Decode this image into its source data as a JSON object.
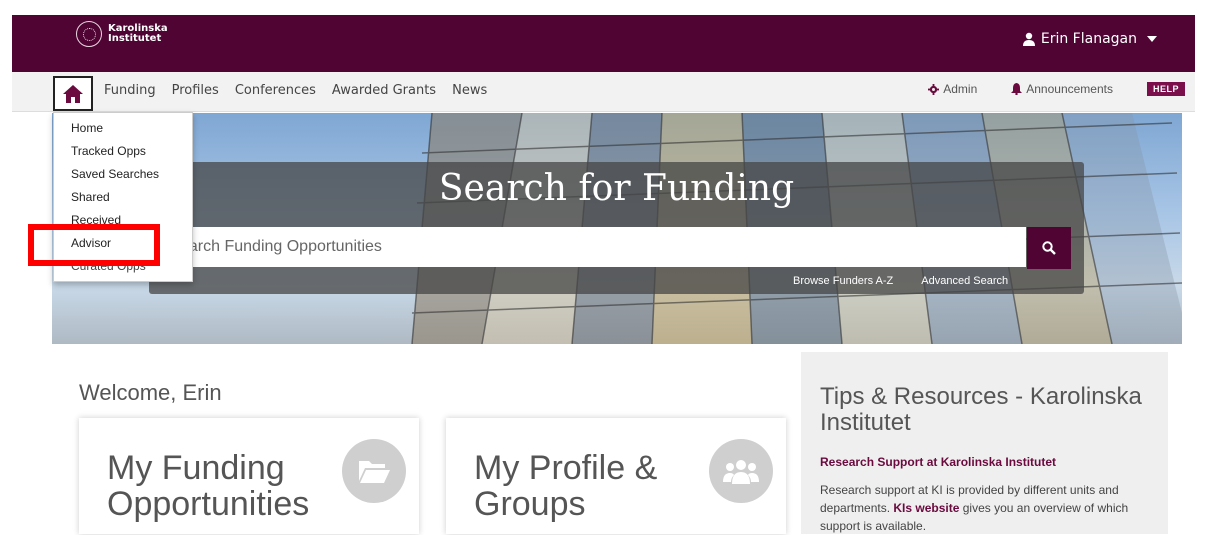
{
  "header": {
    "logo_line1": "Karolinska",
    "logo_line2": "Institutet",
    "user_name": "Erin Flanagan"
  },
  "nav": {
    "links": [
      "Funding",
      "Profiles",
      "Conferences",
      "Awarded Grants",
      "News"
    ],
    "admin": "Admin",
    "announcements": "Announcements",
    "help": "HELP"
  },
  "dropdown": {
    "items": [
      "Home",
      "Tracked Opps",
      "Saved Searches",
      "Shared",
      "Received",
      "Advisor",
      "Curated Opps"
    ]
  },
  "hero": {
    "title": "Search for Funding",
    "search_placeholder": "earch Funding Opportunities",
    "browse_link": "Browse Funders A-Z",
    "advanced_link": "Advanced Search"
  },
  "main": {
    "welcome": "Welcome, Erin",
    "card1_title": "My Funding Opportunities",
    "card2_title": "My Profile & Groups"
  },
  "tips": {
    "title": "Tips & Resources - Karolinska Institutet",
    "subtitle": "Research Support at Karolinska Institutet",
    "body_pre": "Research support at KI is provided by different units and departments. ",
    "body_link": "KIs website",
    "body_post": " gives you an overview of which support is available."
  },
  "colors": {
    "brand": "#4f0433",
    "accent_text": "#6a0a3e",
    "highlight": "#ff0000"
  }
}
